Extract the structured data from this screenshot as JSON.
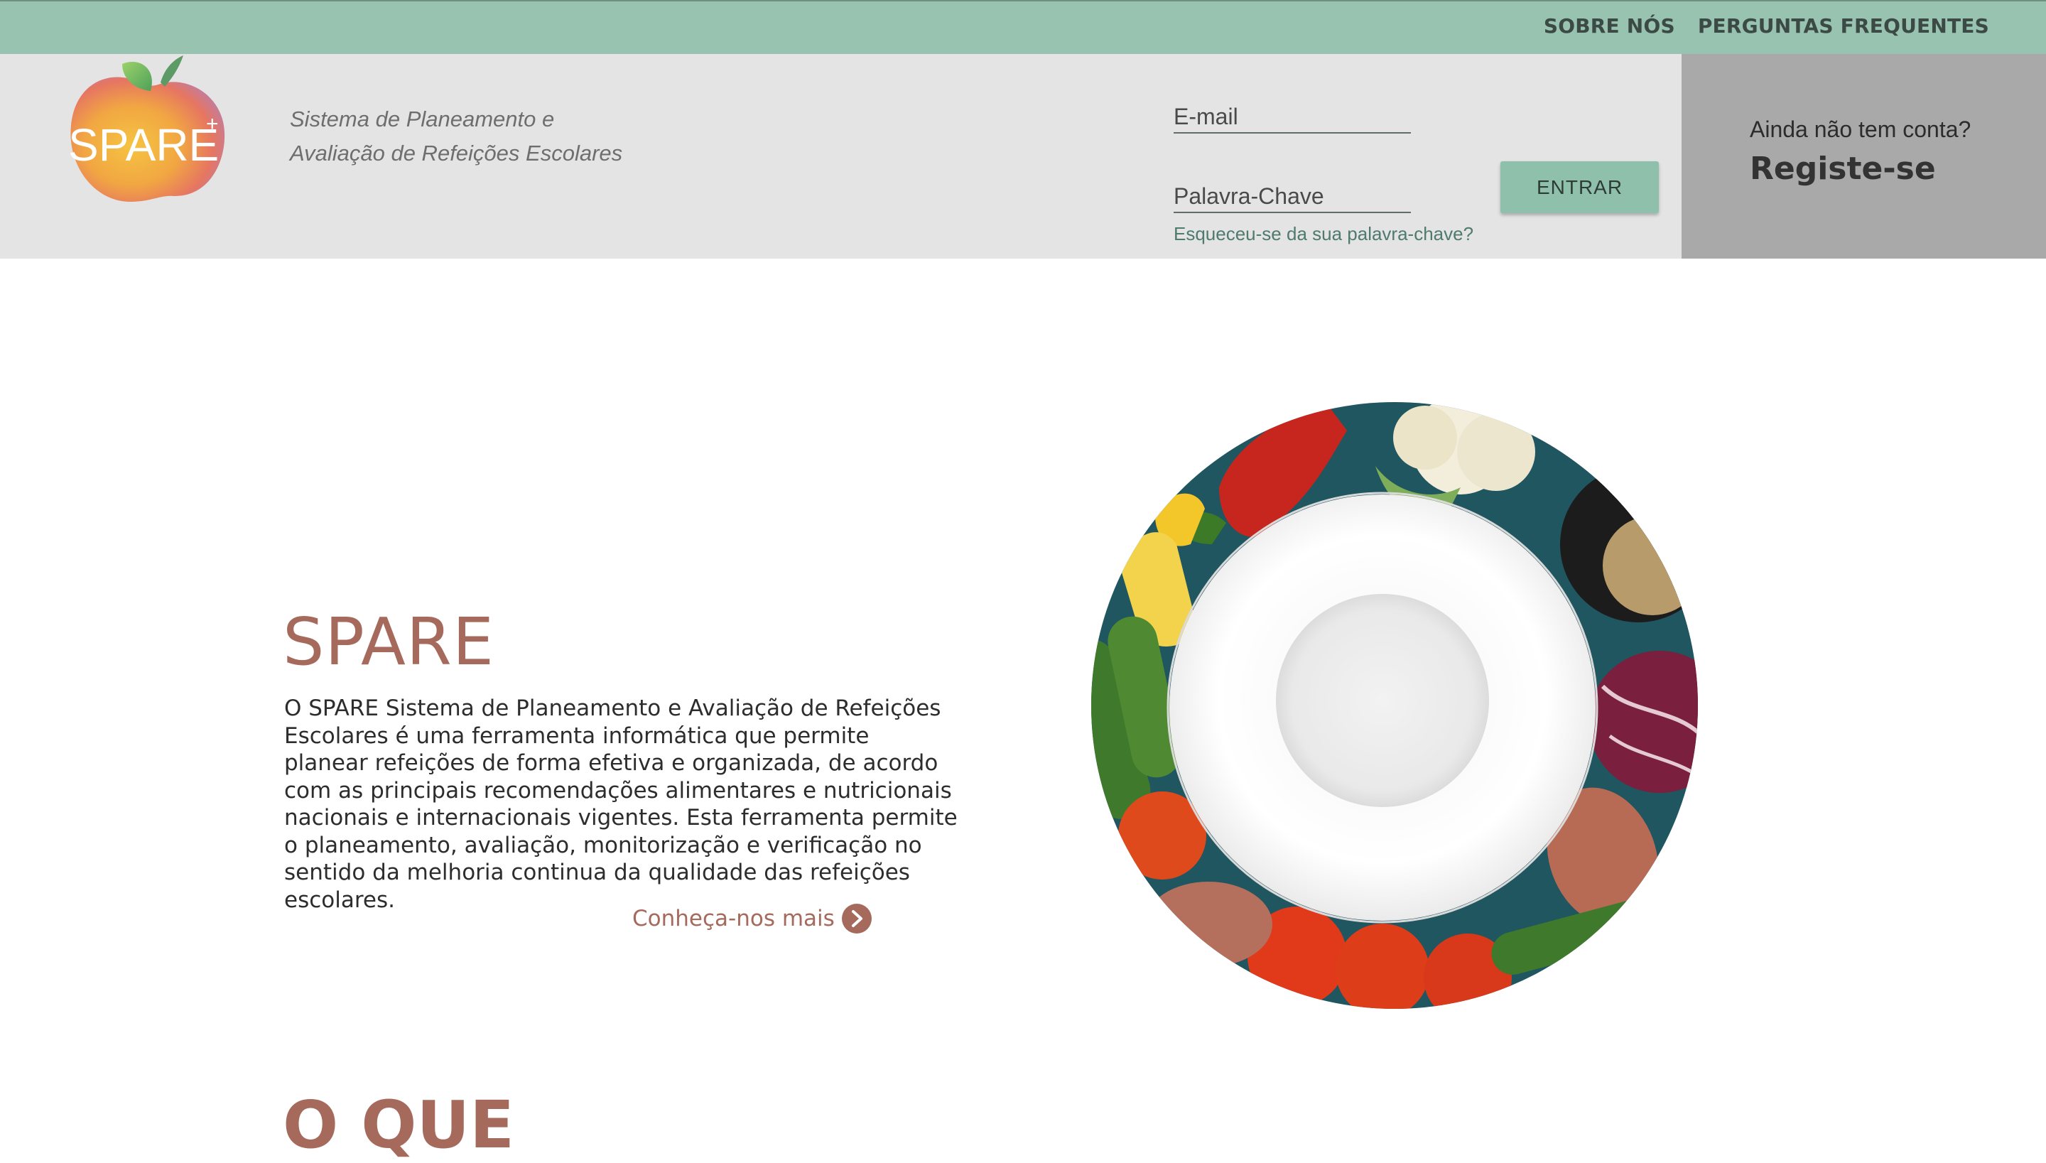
{
  "topnav": {
    "about": "SOBRE NÓS",
    "faq": "PERGUNTAS FREQUENTES"
  },
  "brand": {
    "logo_text": "SPARE",
    "logo_plus": "+",
    "tagline_line1": "Sistema de Planeamento e",
    "tagline_line2": "Avaliação de Refeições Escolares"
  },
  "login": {
    "email_placeholder": "E-mail",
    "password_placeholder": "Palavra-Chave",
    "submit_label": "ENTRAR",
    "forgot_label": "Esqueceu-se da sua palavra-chave?"
  },
  "register": {
    "question": "Ainda não tem conta?",
    "link_label": "Registe-se"
  },
  "hero": {
    "title": "SPARE",
    "description": "O SPARE Sistema de Planeamento e Avaliação de Refeições Escolares é uma ferramenta informática que permite planear refeições de forma efetiva e organizada, de acordo com as principais recomendações alimentares e nutricionais nacionais e internacionais vigentes. Esta ferramenta permite o planeamento, avaliação, monitorização e verificação no sentido da melhoria continua da qualidade das refeições escolares.",
    "more_label": "Conheça-nos mais"
  },
  "next_section": {
    "title": "O QUE"
  },
  "colors": {
    "topbar": "#98c3b0",
    "header_bg": "#e4e4e4",
    "register_bg": "#a9a9a9",
    "button": "#8fc0ab",
    "accent": "#a66a5d"
  }
}
